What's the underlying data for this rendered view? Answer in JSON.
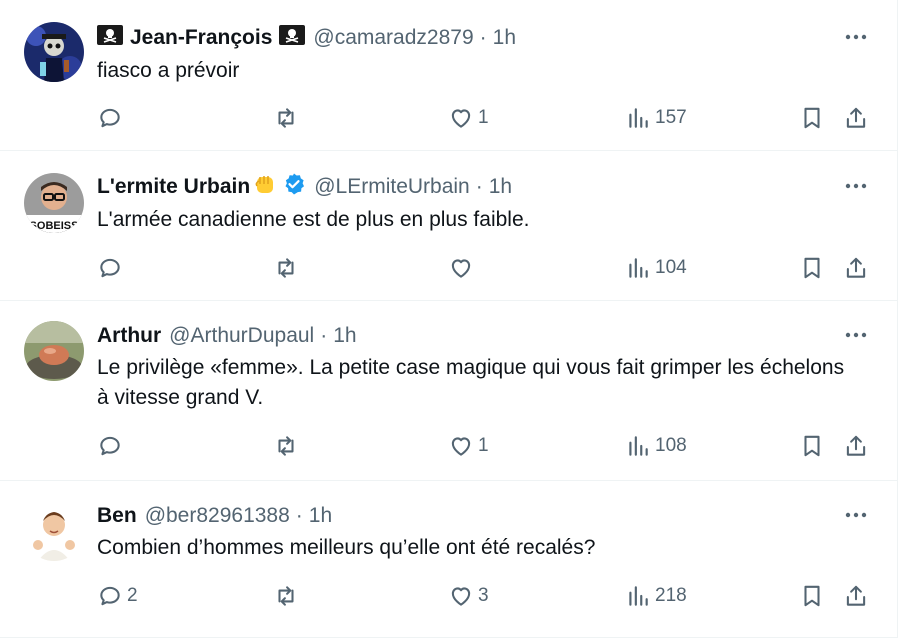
{
  "colors": {
    "text": "#0f1419",
    "muted": "#536471",
    "divider": "#eff3f4",
    "verified": "#1d9bf0"
  },
  "tweets": [
    {
      "name": "Jean-François",
      "handle": "@camaradz2879",
      "time": "1h",
      "text": "fiasco a prévoir",
      "reply_count": "",
      "retweet_count": "",
      "like_count": "1",
      "view_count": "157"
    },
    {
      "name": "L'ermite Urbain",
      "handle": "@LErmiteUrbain",
      "time": "1h",
      "text": "L'armée canadienne est de plus en plus faible.",
      "reply_count": "",
      "retweet_count": "",
      "like_count": "",
      "view_count": "104",
      "avatar_caption": "SOBEISS"
    },
    {
      "name": "Arthur",
      "handle": "@ArthurDupaul",
      "time": "1h",
      "text": "Le privilège «femme». La petite case magique qui vous fait grimper les échelons à vitesse grand V.",
      "reply_count": "",
      "retweet_count": "",
      "like_count": "1",
      "view_count": "108"
    },
    {
      "name": "Ben",
      "handle": "@ber82961388",
      "time": "1h",
      "text": "Combien d’hommes meilleurs qu’elle ont été recalés?",
      "reply_count": "2",
      "retweet_count": "",
      "like_count": "3",
      "view_count": "218"
    }
  ],
  "dot_separator": "·",
  "icons": [
    "pirate-flag-icon",
    "raised-fist-emoji",
    "verified-badge-icon",
    "more-icon",
    "reply-icon",
    "retweet-icon",
    "like-icon",
    "views-icon",
    "bookmark-icon",
    "share-icon"
  ]
}
